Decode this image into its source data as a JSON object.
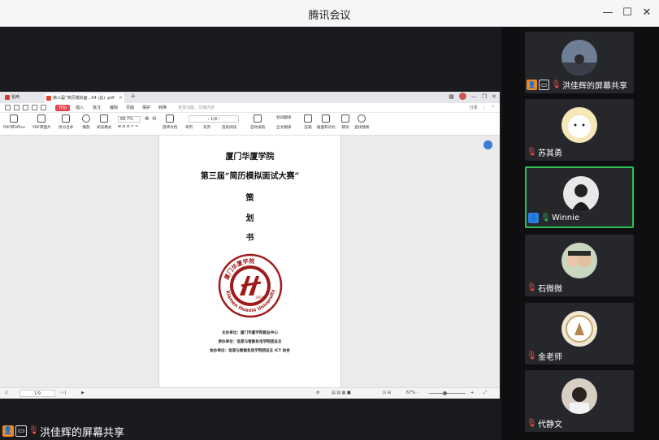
{
  "window": {
    "title": "腾讯会议",
    "minimize": "—",
    "maximize": "☐",
    "close": "✕"
  },
  "pdf_viewer": {
    "tabs": {
      "home_label": "稻壳",
      "doc_label": "第三届“简历模拟面...04 (此) .pdf",
      "close": "×",
      "new_tab": "+"
    },
    "menu": {
      "items": [
        "开始",
        "插入",
        "批注",
        "编辑",
        "页面",
        "保护",
        "转换"
      ],
      "active": "开始",
      "search_placeholder": "查找功能、文档内容",
      "right": [
        "分享",
        "⋮",
        "^"
      ]
    },
    "ribbon": {
      "buttons": [
        "PDF转Office",
        "PDF转图片",
        "拆分合并",
        "播放",
        "阅读模式",
        "旋转文档",
        "单页",
        "双页",
        "连续阅读",
        "自动滚动",
        "划词翻译",
        "全文翻译",
        "压缩",
        "截图和对比",
        "朗读",
        "查找替换"
      ],
      "zoom": "68.7%",
      "page_indicator": "1/9"
    },
    "document": {
      "line1": "厦门华厦学院",
      "line2": "第三届“简历模拟面试大赛”",
      "line3": "策",
      "line4": "划",
      "line5": "书",
      "seal_top_text": "厦门华厦学院",
      "seal_bottom_text": "Xiamen Huaxia University",
      "seal_year": "1993",
      "organizers": [
        "主办单位：厦门华厦学院就业中心",
        "承办单位：信息与智能机电学院团总支",
        "协办单位：信息与智能机电学院团总支 ICT 协会"
      ]
    },
    "statusbar": {
      "page": "1/9",
      "zoom": "67% -",
      "plus": "+"
    }
  },
  "sharer": {
    "label": "洪佳辉的屏幕共享"
  },
  "participants": [
    {
      "name": "洪佳辉的屏幕共享",
      "mic": "muted",
      "role_badge": "host",
      "speaking": false
    },
    {
      "name": "苏其勇",
      "mic": "muted",
      "role_badge": "",
      "speaking": false
    },
    {
      "name": "Winnie",
      "mic": "active",
      "role_badge": "user",
      "speaking": true
    },
    {
      "name": "石微微",
      "mic": "muted",
      "role_badge": "",
      "speaking": false
    },
    {
      "name": "金老师",
      "mic": "muted",
      "role_badge": "",
      "speaking": false
    },
    {
      "name": "代静文",
      "mic": "muted",
      "role_badge": "",
      "speaking": false
    }
  ],
  "colors": {
    "accent_red": "#e8464f",
    "mic_muted": "#ff4d4f",
    "mic_active": "#27c24c",
    "speaking_border": "#2ec254",
    "host_badge": "#f08a24",
    "user_badge": "#2f7de1",
    "seal": "#9e1b1b"
  }
}
